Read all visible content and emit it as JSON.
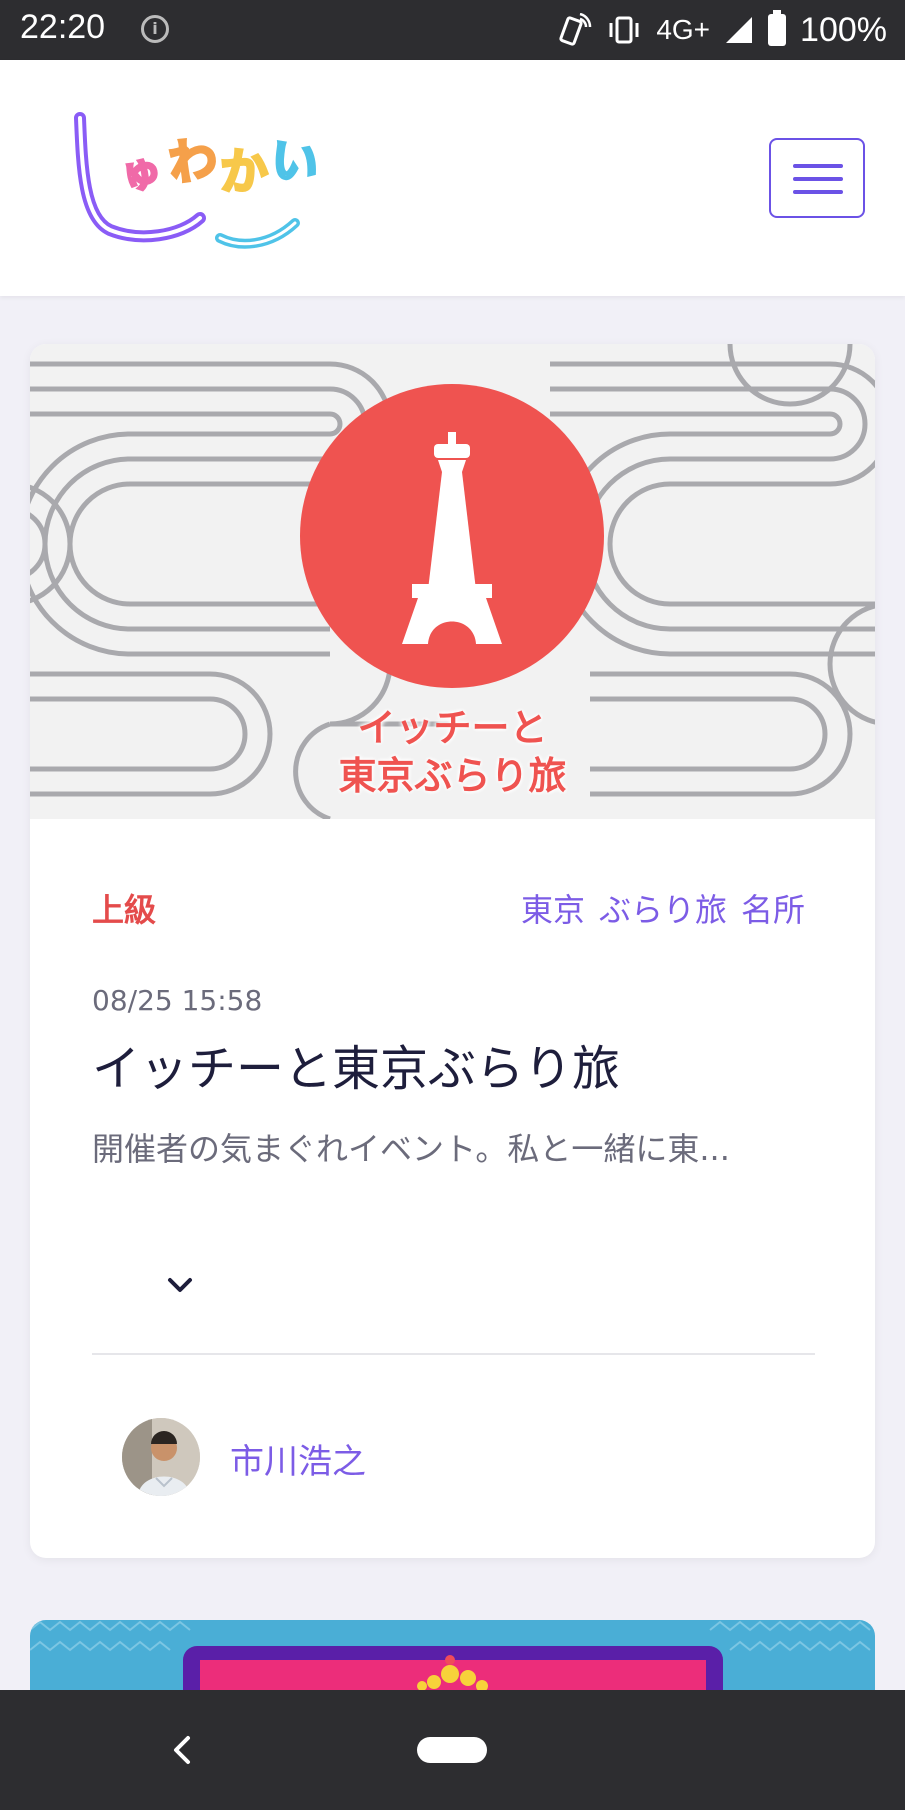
{
  "status_bar": {
    "time": "22:20",
    "network": "4G+",
    "battery": "100%"
  },
  "header": {
    "logo_text": "しゅわかい"
  },
  "event": {
    "banner_title_line1": "イッチーと",
    "banner_title_line2": "東京ぶらり旅",
    "level": "上級",
    "tags": [
      "東京",
      "ぶらり旅",
      "名所"
    ],
    "datetime": "08/25 15:58",
    "title": "イッチーと東京ぶらり旅",
    "description": "開催者の気まぐれイベント。私と一緒に東...",
    "author": "市川浩之"
  },
  "colors": {
    "accent": "#6b52e6",
    "level": "#e44b4b",
    "banner_circle": "#ef5350"
  }
}
